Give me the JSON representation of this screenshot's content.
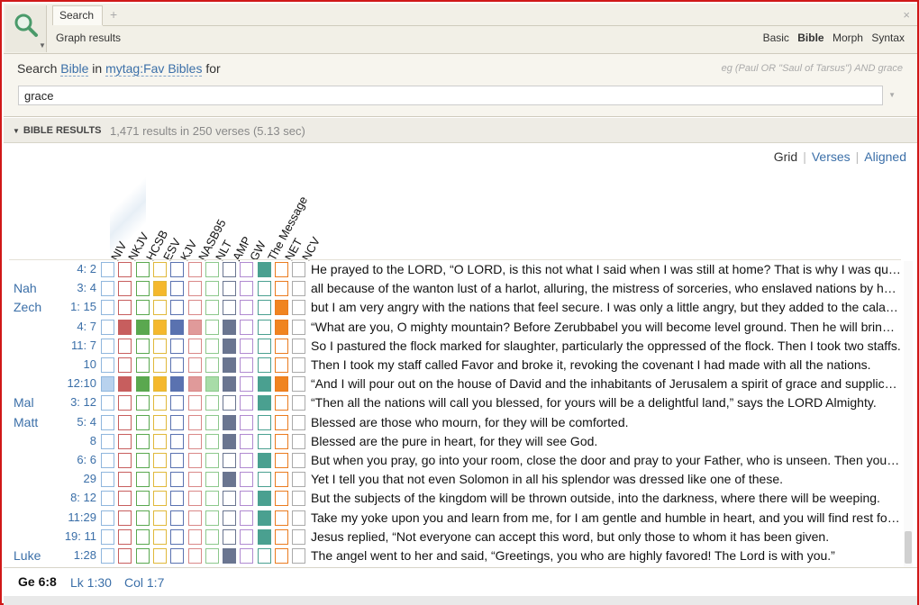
{
  "colors": {
    "accent": "#3b6fa8",
    "frame_border": "#d01818",
    "grid_cols": [
      "#8fb6dd",
      "#c75e5e",
      "#5aa84f",
      "#e0b83a",
      "#5a72b0",
      "#d98888",
      "#8cc88c",
      "#6a7590",
      "#b08ad0",
      "#4aa090",
      "#ea7b1f",
      "#aaaaaa"
    ],
    "grid_fill": [
      "#b8d2ee",
      "#c75e5e",
      "#5aa84f",
      "#f5b82c",
      "#5a72b0",
      "#e09a9a",
      "#a8dca8",
      "#6a7590",
      "#c8aee0",
      "#4aa090",
      "#f08420",
      "#cccccc"
    ]
  },
  "toolbar": {
    "tab_label": "Search",
    "plus_label": "+",
    "close_label": "×",
    "graph_results": "Graph results",
    "modes": [
      "Basic",
      "Bible",
      "Morph",
      "Syntax"
    ],
    "active_mode": "Bible"
  },
  "search": {
    "prefix": "Search",
    "scope": "Bible",
    "in_word": "in",
    "collection": "mytag:Fav Bibles",
    "for_word": "for",
    "example": "eg (Paul OR \"Saul of Tarsus\") AND grace",
    "value": "grace"
  },
  "results": {
    "title": "BIBLE RESULTS",
    "count": "1,471 results in 250 verses (5.13 sec)"
  },
  "views": {
    "grid": "Grid",
    "verses": "Verses",
    "aligned": "Aligned"
  },
  "columns": [
    "NIV",
    "NKJV",
    "HCSB",
    "ESV",
    "KJV",
    "NASB95",
    "NLT",
    "AMP",
    "GW",
    "The Message",
    "NET",
    "NCV"
  ],
  "rows": [
    {
      "book": "",
      "ref": "4:  2",
      "cells": [
        0,
        0,
        0,
        0,
        0,
        0,
        0,
        0,
        0,
        1,
        0,
        0
      ],
      "text": "He prayed to the LORD, “O LORD, is this not what I said when I was still at home? That is why I was quick to flee to Tarshish."
    },
    {
      "book": "Nah",
      "ref": "3:  4",
      "cells": [
        0,
        0,
        0,
        1,
        0,
        0,
        0,
        0,
        0,
        0,
        0,
        0
      ],
      "text": "all because of the wanton lust of a harlot, alluring, the mistress of sorceries, who enslaved nations by her prostitution."
    },
    {
      "book": "Zech",
      "ref": "1: 15",
      "cells": [
        0,
        0,
        0,
        0,
        0,
        0,
        0,
        0,
        0,
        0,
        1,
        0
      ],
      "text": "but I am very angry with the nations that feel secure. I was only a little angry, but they added to the calamity."
    },
    {
      "book": "",
      "ref": "4:  7",
      "cells": [
        0,
        1,
        1,
        1,
        1,
        1,
        0,
        1,
        0,
        0,
        1,
        0
      ],
      "text": "“What are you, O mighty mountain? Before Zerubbabel you will become level ground. Then he will bring out the capstone."
    },
    {
      "book": "",
      "ref": "11:  7",
      "cells": [
        0,
        0,
        0,
        0,
        0,
        0,
        0,
        1,
        0,
        0,
        0,
        0
      ],
      "text": "So I pastured the flock marked for slaughter, particularly the oppressed of the flock. Then I took two staffs."
    },
    {
      "book": "",
      "ref": "10",
      "cells": [
        0,
        0,
        0,
        0,
        0,
        0,
        0,
        1,
        0,
        0,
        0,
        0
      ],
      "text": "Then I took my staff called Favor and broke it, revoking the covenant I had made with all the nations."
    },
    {
      "book": "",
      "ref": "12:10",
      "cells": [
        1,
        1,
        1,
        1,
        1,
        1,
        1,
        1,
        0,
        1,
        1,
        0
      ],
      "text": " “And I will pour out on the house of David and the inhabitants of Jerusalem a spirit of grace and supplication."
    },
    {
      "book": "Mal",
      "ref": "3: 12",
      "cells": [
        0,
        0,
        0,
        0,
        0,
        0,
        0,
        0,
        0,
        1,
        0,
        0
      ],
      "text": "“Then all the nations will call you blessed, for yours will be a delightful land,” says the LORD Almighty."
    },
    {
      "book": "Matt",
      "ref": "5:  4",
      "cells": [
        0,
        0,
        0,
        0,
        0,
        0,
        0,
        1,
        0,
        0,
        0,
        0
      ],
      "text": "Blessed are those who mourn, for they will be comforted."
    },
    {
      "book": "",
      "ref": "8",
      "cells": [
        0,
        0,
        0,
        0,
        0,
        0,
        0,
        1,
        0,
        0,
        0,
        0
      ],
      "text": "Blessed are the pure in heart, for they will see God."
    },
    {
      "book": "",
      "ref": "6:  6",
      "cells": [
        0,
        0,
        0,
        0,
        0,
        0,
        0,
        0,
        0,
        1,
        0,
        0
      ],
      "text": "But when you pray, go into your room, close the door and pray to your Father, who is unseen. Then your Father will reward you."
    },
    {
      "book": "",
      "ref": "29",
      "cells": [
        0,
        0,
        0,
        0,
        0,
        0,
        0,
        1,
        0,
        0,
        0,
        0
      ],
      "text": "Yet I tell you that not even Solomon in all his splendor was dressed like one of these."
    },
    {
      "book": "",
      "ref": "8: 12",
      "cells": [
        0,
        0,
        0,
        0,
        0,
        0,
        0,
        0,
        0,
        1,
        0,
        0
      ],
      "text": "But the subjects of the kingdom will be thrown outside, into the darkness, where there will be weeping."
    },
    {
      "book": "",
      "ref": "11:29",
      "cells": [
        0,
        0,
        0,
        0,
        0,
        0,
        0,
        0,
        0,
        1,
        0,
        0
      ],
      "text": "Take my yoke upon you and learn from me, for I am gentle and humble in heart, and you will find rest for your souls."
    },
    {
      "book": "",
      "ref": "19: 11",
      "cells": [
        0,
        0,
        0,
        0,
        0,
        0,
        0,
        0,
        0,
        1,
        0,
        0
      ],
      "text": "Jesus replied, “Not everyone can accept this word, but only those to whom it has been given."
    },
    {
      "book": "Luke",
      "ref": "1:28",
      "cells": [
        0,
        0,
        0,
        0,
        0,
        0,
        0,
        1,
        0,
        0,
        0,
        0
      ],
      "text": "The angel went to her and said, “Greetings, you who are highly favored! The Lord is with you.”"
    }
  ],
  "bottom": {
    "current": "Ge 6:8",
    "link1": "Lk 1:30",
    "link2": "Col 1:7"
  }
}
